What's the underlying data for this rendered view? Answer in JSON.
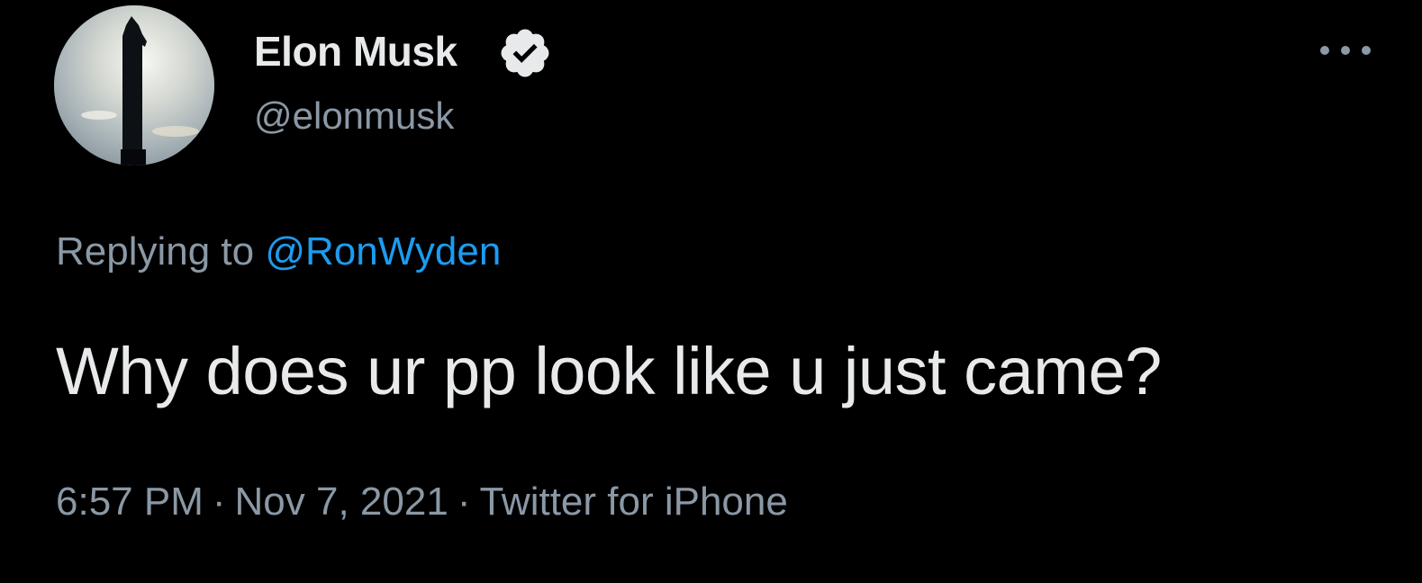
{
  "author": {
    "display_name": "Elon Musk",
    "handle": "@elonmusk",
    "verified": true,
    "avatar_icon": "starship-silhouette-avatar"
  },
  "more_icon": "more-horizontal-icon",
  "reply": {
    "prefix": "Replying to ",
    "mention": "@RonWyden"
  },
  "tweet": {
    "text": "Why does ur pp look like u just came?"
  },
  "meta": {
    "time": "6:57 PM",
    "separator": "·",
    "date": "Nov 7, 2021",
    "source": "Twitter for iPhone"
  },
  "colors": {
    "background": "#000000",
    "primary_text": "#e7e9ea",
    "secondary_text": "#8b98a5",
    "link": "#1d9bf0",
    "badge": "#e7e9ea"
  }
}
